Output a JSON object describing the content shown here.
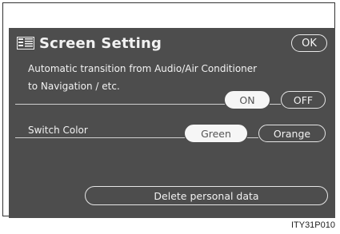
{
  "header": {
    "title": "Screen Setting",
    "menu_icon": "screen-setting-icon",
    "ok_label": "OK"
  },
  "auto_transition": {
    "label_line1": "Automatic transition from Audio/Air Conditioner",
    "label_line2": "to Navigation / etc.",
    "on_label": "ON",
    "off_label": "OFF",
    "selected": "ON"
  },
  "switch_color": {
    "label": "Switch Color",
    "green_label": "Green",
    "orange_label": "Orange",
    "selected": "Green"
  },
  "delete_label": "Delete personal data",
  "caption": "ITY31P010",
  "colors": {
    "screen_bg": "#4d4d4d",
    "selected_bg": "#f6f6f6",
    "text": "#f2f2f2"
  }
}
